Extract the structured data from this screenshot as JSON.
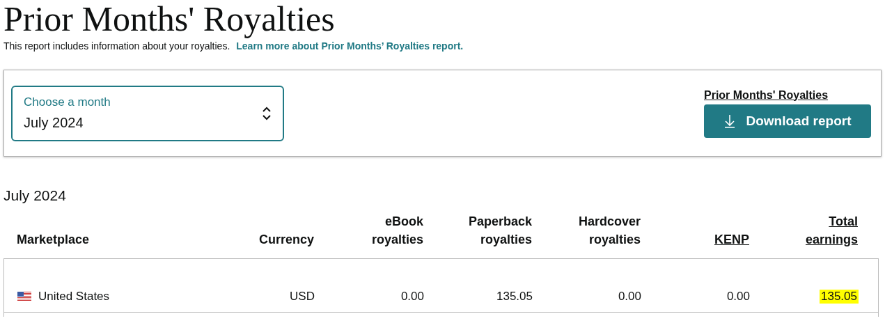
{
  "title": "Prior Months' Royalties",
  "intro": {
    "text": "This report includes information about your royalties.",
    "link": "Learn more about Prior Months’ Royalties report."
  },
  "month_select": {
    "label": "Choose a month",
    "value": "July 2024"
  },
  "report_link": "Prior Months' Royalties",
  "download_button": "Download report",
  "section_title": "July 2024",
  "table": {
    "columns": [
      {
        "label": "Marketplace",
        "link": false
      },
      {
        "label": "Currency",
        "link": false
      },
      {
        "label": "eBook royalties",
        "link": false
      },
      {
        "label": "Paperback royalties",
        "link": false
      },
      {
        "label": "Hardcover royalties",
        "link": false
      },
      {
        "label": "KENP",
        "link": true
      },
      {
        "label": "Total earnings",
        "link": true
      }
    ],
    "rows": [
      {
        "cells": [
          {
            "text": "United States",
            "highlighted": false
          },
          {
            "text": "USD",
            "highlighted": false
          },
          {
            "text": "0.00",
            "highlighted": false
          },
          {
            "text": "135.05",
            "highlighted": false
          },
          {
            "text": "0.00",
            "highlighted": false
          },
          {
            "text": "0.00",
            "highlighted": false
          },
          {
            "text": "135.05",
            "highlighted": true
          }
        ]
      }
    ]
  }
}
